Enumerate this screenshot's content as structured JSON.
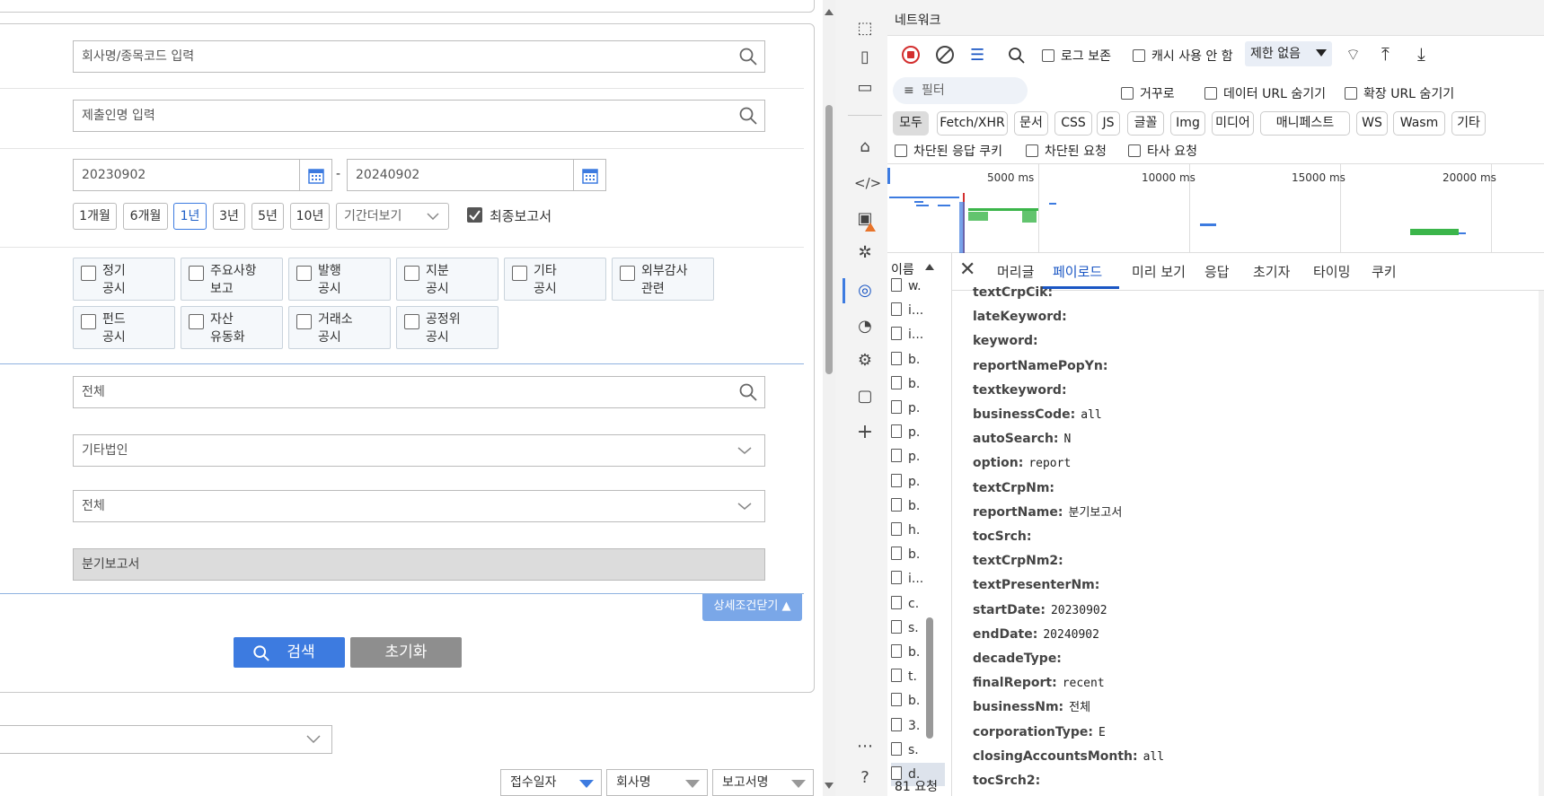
{
  "search": {
    "company_placeholder": "회사명/종목코드 입력",
    "presenter_placeholder": "제출인명 입력",
    "start_date": "20230902",
    "date_dash": "-",
    "end_date": "20240902",
    "periods": [
      "1개월",
      "6개월",
      "1년",
      "3년",
      "5년",
      "10년"
    ],
    "period_more": "기간더보기",
    "final_report_label": "최종보고서",
    "disclosure_types": [
      [
        "정기",
        "공시"
      ],
      [
        "주요사항",
        "보고"
      ],
      [
        "발행",
        "공시"
      ],
      [
        "지분",
        "공시"
      ],
      [
        "기타",
        "공시"
      ],
      [
        "외부감사",
        "관련"
      ],
      [
        "펀드",
        "공시"
      ],
      [
        "자산",
        "유동화"
      ],
      [
        "거래소",
        "공시"
      ],
      [
        "공정위",
        "공시"
      ]
    ],
    "business_value": "전체",
    "corp_type_value": "기타법인",
    "accounts_month_value": "전체",
    "report_name_value": "분기보고서",
    "detail_close_label": "상세조건닫기 ▲",
    "search_button": "검색",
    "reset_button": "초기화",
    "sort": [
      "접수일자",
      "회사명",
      "보고서명"
    ]
  },
  "devtools": {
    "panel_title": "네트워크",
    "preserve_log": "로그 보존",
    "disable_cache": "캐시 사용 안 함",
    "throttle": "제한 없음",
    "filter_placeholder": "필터",
    "invert": "거꾸로",
    "hide_data_urls": "데이터 URL 숨기기",
    "hide_ext_urls": "확장 URL 숨기기",
    "types": [
      "모두",
      "Fetch/XHR",
      "문서",
      "CSS",
      "JS",
      "글꼴",
      "Img",
      "미디어",
      "매니페스트",
      "WS",
      "Wasm",
      "기타"
    ],
    "blocked_cookies": "차단된 응답 쿠키",
    "blocked_requests": "차단된 요청",
    "third_party": "타사 요청",
    "timeline_ticks": [
      "5000 ms",
      "10000 ms",
      "15000 ms",
      "20000 ms"
    ],
    "name_header": "이름",
    "files": [
      "w.",
      "i...",
      "i...",
      "b.",
      "b.",
      "p.",
      "p.",
      "p.",
      "p.",
      "b.",
      "h.",
      "b.",
      "i...",
      "c.",
      "s.",
      "b.",
      "t.",
      "b.",
      "3.",
      "s.",
      "d."
    ],
    "request_count": "81 요청",
    "detail_tabs": [
      "머리글",
      "페이로드",
      "미리 보기",
      "응답",
      "초기자",
      "타이밍",
      "쿠키"
    ],
    "payload": [
      {
        "k": "textCrpCik:",
        "v": ""
      },
      {
        "k": "lateKeyword:",
        "v": ""
      },
      {
        "k": "keyword:",
        "v": ""
      },
      {
        "k": "reportNamePopYn:",
        "v": ""
      },
      {
        "k": "textkeyword:",
        "v": ""
      },
      {
        "k": "businessCode:",
        "v": "all"
      },
      {
        "k": "autoSearch:",
        "v": "N"
      },
      {
        "k": "option:",
        "v": "report"
      },
      {
        "k": "textCrpNm:",
        "v": ""
      },
      {
        "k": "reportName:",
        "v": "분기보고서"
      },
      {
        "k": "tocSrch:",
        "v": ""
      },
      {
        "k": "textCrpNm2:",
        "v": ""
      },
      {
        "k": "textPresenterNm:",
        "v": ""
      },
      {
        "k": "startDate:",
        "v": "20230902"
      },
      {
        "k": "endDate:",
        "v": "20240902"
      },
      {
        "k": "decadeType:",
        "v": ""
      },
      {
        "k": "finalReport:",
        "v": "recent"
      },
      {
        "k": "businessNm:",
        "v": "전체"
      },
      {
        "k": "corporationType:",
        "v": "E"
      },
      {
        "k": "closingAccountsMonth:",
        "v": "all"
      },
      {
        "k": "tocSrch2:",
        "v": ""
      }
    ]
  }
}
